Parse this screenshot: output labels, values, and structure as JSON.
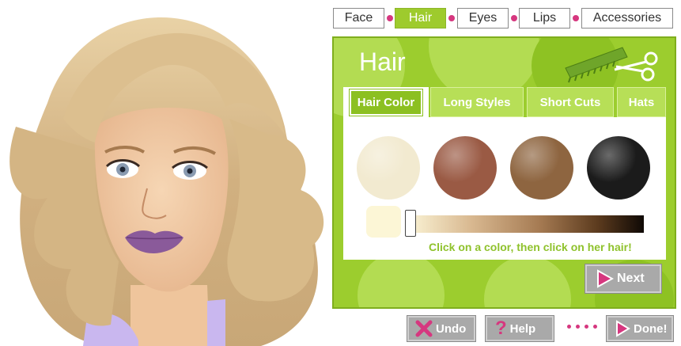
{
  "nav": {
    "tabs": [
      {
        "label": "Face"
      },
      {
        "label": "Hair"
      },
      {
        "label": "Eyes"
      },
      {
        "label": "Lips"
      },
      {
        "label": "Accessories"
      }
    ],
    "active_tab": "Hair"
  },
  "panel": {
    "title": "Hair",
    "icons": [
      "comb-icon",
      "scissors-icon"
    ],
    "subtabs": [
      {
        "label": "Hair Color"
      },
      {
        "label": "Long Styles"
      },
      {
        "label": "Short Cuts"
      },
      {
        "label": "Hats"
      }
    ],
    "active_subtab": "Hair Color",
    "swatch_colors": [
      "#f2ead0",
      "#9a5a44",
      "#8e6540",
      "#1b1b1b"
    ],
    "preview_color": "#fcf6d6",
    "slider_level": 0,
    "hint": "Click on a color, then click on her hair!",
    "next_label": "Next"
  },
  "footer": {
    "undo_label": "Undo",
    "help_label": "Help",
    "done_label": "Done!"
  },
  "colors": {
    "accent": "#9ecb2d",
    "dot": "#d6377f",
    "button_gray": "#a9a9a9"
  }
}
